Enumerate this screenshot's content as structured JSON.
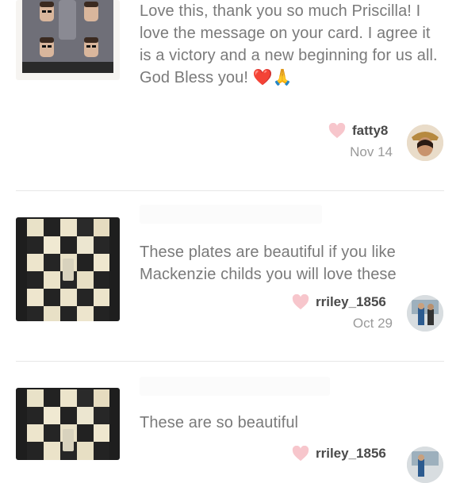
{
  "comments": [
    {
      "text": "Love this, thank you so much Priscilla! I love the message on your card. I agree it is a victory and a new beginning for us all. God Bless you!",
      "emoji": "❤️🙏",
      "username": "fatty8",
      "date": "Nov 14"
    },
    {
      "text": "These plates are beautiful if you like Mackenzie childs you will love these",
      "username": "rriley_1856",
      "date": "Oct 29"
    },
    {
      "text": "These are so beautiful",
      "username": "rriley_1856",
      "date": ""
    }
  ],
  "colors": {
    "heart": "#f7c6cc",
    "divider": "#e6e6e6",
    "text": "#7a7a7a"
  }
}
